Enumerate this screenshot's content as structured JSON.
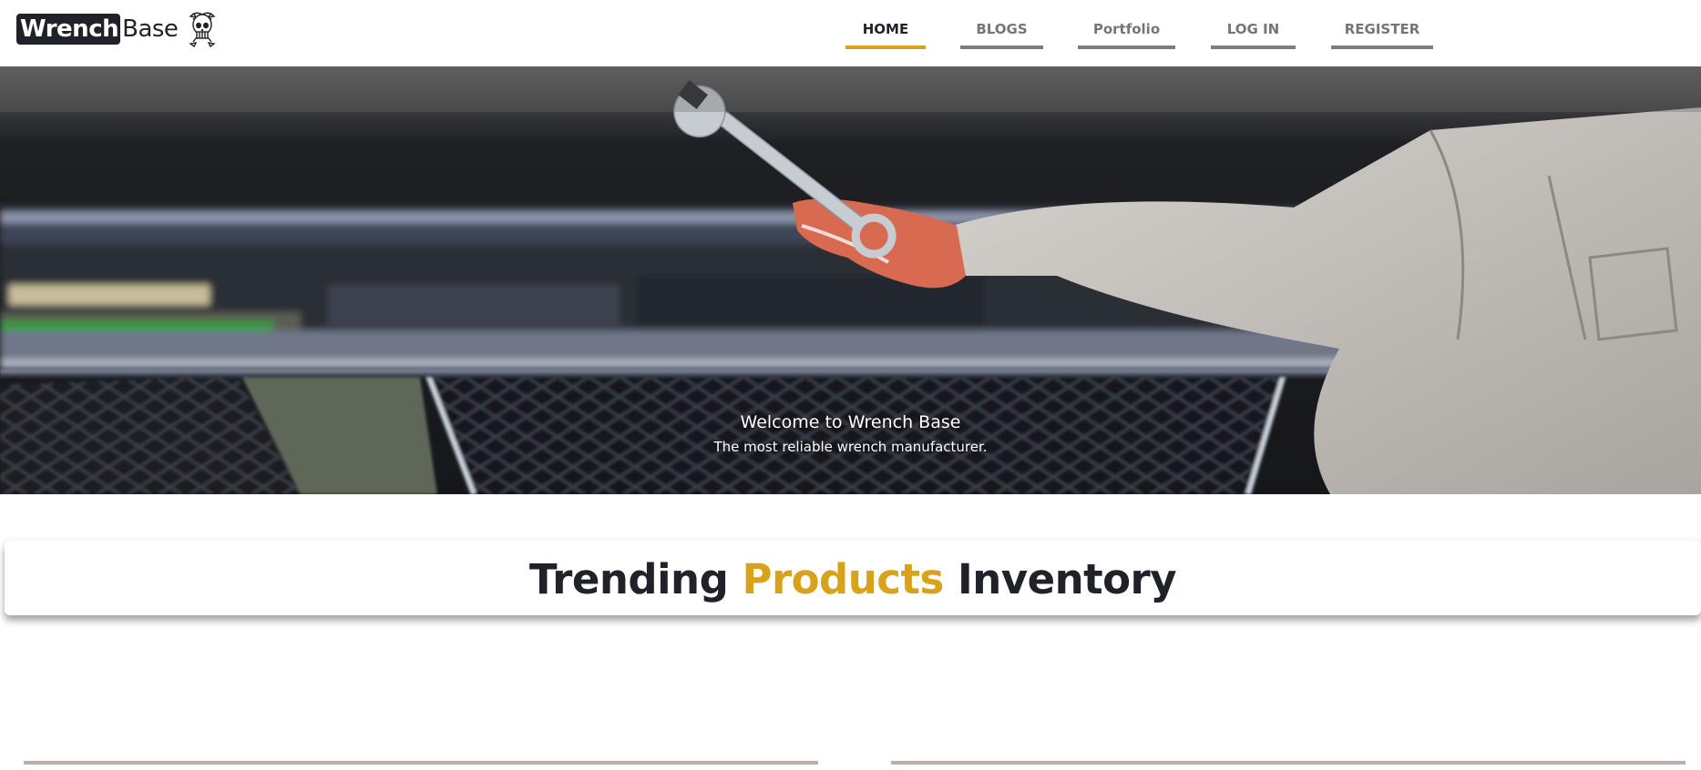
{
  "brand": {
    "part1": "Wrench",
    "part2": "Base",
    "mascot_icon": "skull-mascot-icon"
  },
  "nav": {
    "items": [
      {
        "label": "HOME",
        "active": true
      },
      {
        "label": "BLOGS",
        "active": false
      },
      {
        "label": "Portfolio",
        "active": false
      },
      {
        "label": "LOG IN",
        "active": false
      },
      {
        "label": "REGISTER",
        "active": false
      }
    ]
  },
  "hero": {
    "title": "Welcome to Wrench Base",
    "subtitle": "The most reliable wrench manufacturer."
  },
  "section": {
    "title_part1": "Trending",
    "title_accent": "Products",
    "title_part2": "Inventory"
  },
  "colors": {
    "accent": "#d9a21b",
    "dark": "#1f2329",
    "nav_underline": "#7d7d7d",
    "card_border": "#bcaea8"
  }
}
